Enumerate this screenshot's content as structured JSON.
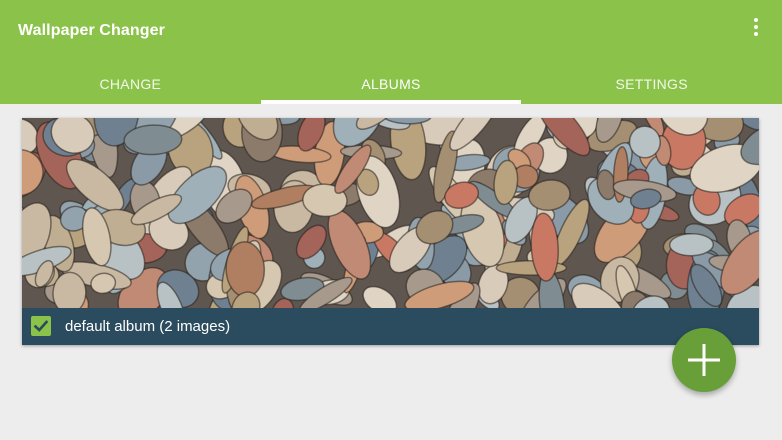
{
  "app": {
    "title": "Wallpaper Changer",
    "overflow_icon": "more-vert-icon"
  },
  "tabs": [
    {
      "label": "CHANGE",
      "selected": false
    },
    {
      "label": "ALBUMS",
      "selected": true
    },
    {
      "label": "SETTINGS",
      "selected": false
    }
  ],
  "album": {
    "label": "default album (2 images)",
    "checked": true,
    "cover": "pebbles-photo"
  },
  "fab": {
    "icon": "add-icon"
  },
  "colors": {
    "primary": "#8bc34a",
    "fab": "#689f38",
    "card_footer": "#2b4b5e",
    "background": "#ededed"
  }
}
